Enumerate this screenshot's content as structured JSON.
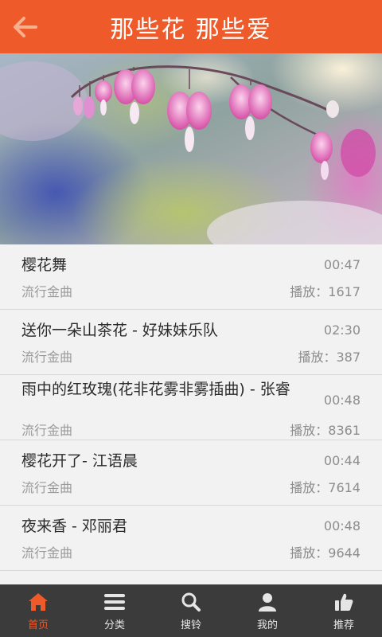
{
  "header": {
    "title": "那些花 那些爱",
    "back_icon": "back-arrow-icon"
  },
  "colors": {
    "accent": "#ee5a2a",
    "nav_bg": "#3b3b3b",
    "list_bg": "#f2f2f2"
  },
  "songs": [
    {
      "title": "樱花舞",
      "duration": "00:47",
      "category": "流行金曲",
      "plays": "播放：1617"
    },
    {
      "title": "送你一朵山茶花 - 好妹妹乐队",
      "duration": "02:30",
      "category": "流行金曲",
      "plays": "播放：387"
    },
    {
      "title": "雨中的红玫瑰(花非花雾非雾插曲) - 张睿",
      "duration": "00:48",
      "category": "流行金曲",
      "plays": "播放：8361"
    },
    {
      "title": "樱花开了- 江语晨",
      "duration": "00:44",
      "category": "流行金曲",
      "plays": "播放：7614"
    },
    {
      "title": "夜来香 - 邓丽君",
      "duration": "00:48",
      "category": "流行金曲",
      "plays": "播放：9644"
    }
  ],
  "nav": [
    {
      "label": "首页",
      "icon": "home-icon",
      "active": true
    },
    {
      "label": "分类",
      "icon": "menu-icon",
      "active": false
    },
    {
      "label": "搜铃",
      "icon": "search-icon",
      "active": false
    },
    {
      "label": "我的",
      "icon": "user-icon",
      "active": false
    },
    {
      "label": "推荐",
      "icon": "thumbs-up-icon",
      "active": false
    }
  ]
}
